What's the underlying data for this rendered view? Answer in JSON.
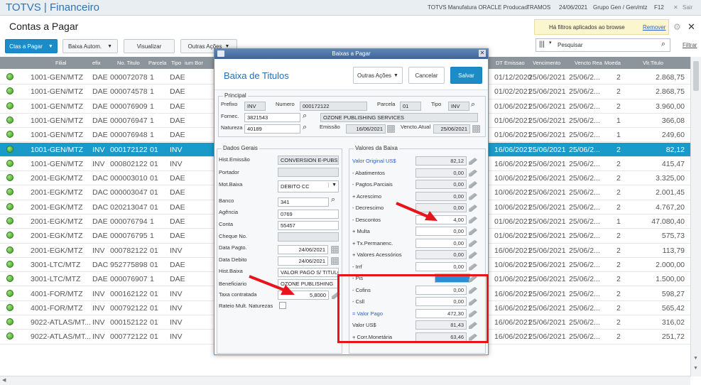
{
  "app": {
    "title": "TOTVS | Financeiro",
    "company": "TOTVS Manufatura ORACLE Producao",
    "user": "TRAMOS",
    "date": "24/06/2021",
    "group": "Grupo Gen / Gen/mtz",
    "key": "F12",
    "exit": "Sair"
  },
  "page": {
    "title": "Contas a Pagar",
    "filter_notice": "Há filtros aplicados ao browse",
    "filter_remove": "Remover",
    "search_placeholder": "Pesquisar",
    "filtrar": "Filtrar"
  },
  "toolbar": {
    "ctas": "Ctas a Pagar",
    "baixa": "Baixa Autom.",
    "visualizar": "Visualizar",
    "outras": "Outras Ações"
  },
  "grid": {
    "headers": [
      "Filial",
      "efix",
      "No. Titulo",
      "Parcela",
      "Tipo",
      "ium Bor",
      "DT Emissao",
      "Vencimento",
      "Vencto Rea",
      "Moeda",
      "Vlr.Titulo"
    ],
    "rows": [
      {
        "filial": "1001-GEN/MTZ",
        "pref": "DAE",
        "titulo": "000072078",
        "parc": "1",
        "tipo": "DAE",
        "emissao": "01/12/2020",
        "venc": "25/06/2021",
        "vreal": "25/06/2...",
        "moeda": "2",
        "valor": "2.868,75"
      },
      {
        "filial": "1001-GEN/MTZ",
        "pref": "DAE",
        "titulo": "000074578",
        "parc": "1",
        "tipo": "DAE",
        "emissao": "01/02/2021",
        "venc": "25/06/2021",
        "vreal": "25/06/2...",
        "moeda": "2",
        "valor": "2.868,75"
      },
      {
        "filial": "1001-GEN/MTZ",
        "pref": "DAE",
        "titulo": "000076909",
        "parc": "1",
        "tipo": "DAE",
        "emissao": "01/06/2021",
        "venc": "25/06/2021",
        "vreal": "25/06/2...",
        "moeda": "2",
        "valor": "3.960,00"
      },
      {
        "filial": "1001-GEN/MTZ",
        "pref": "DAE",
        "titulo": "000076947",
        "parc": "1",
        "tipo": "DAE",
        "emissao": "01/06/2021",
        "venc": "25/06/2021",
        "vreal": "25/06/2...",
        "moeda": "1",
        "valor": "366,08"
      },
      {
        "filial": "1001-GEN/MTZ",
        "pref": "DAE",
        "titulo": "000076948",
        "parc": "1",
        "tipo": "DAE",
        "emissao": "01/06/2021",
        "venc": "25/06/2021",
        "vreal": "25/06/2...",
        "moeda": "1",
        "valor": "249,60"
      },
      {
        "filial": "1001-GEN/MTZ",
        "pref": "INV",
        "titulo": "000172122",
        "parc": "01",
        "tipo": "INV",
        "emissao": "16/06/2021",
        "venc": "25/06/2021",
        "vreal": "25/06/2...",
        "moeda": "2",
        "valor": "82,12"
      },
      {
        "filial": "1001-GEN/MTZ",
        "pref": "INV",
        "titulo": "000802122",
        "parc": "01",
        "tipo": "INV",
        "emissao": "16/06/2021",
        "venc": "25/06/2021",
        "vreal": "25/06/2...",
        "moeda": "2",
        "valor": "415,47"
      },
      {
        "filial": "2001-EGK/MTZ",
        "pref": "DAC",
        "titulo": "000003010",
        "parc": "01",
        "tipo": "DAE",
        "emissao": "10/06/2021",
        "venc": "25/06/2021",
        "vreal": "25/06/2...",
        "moeda": "2",
        "valor": "3.325,00"
      },
      {
        "filial": "2001-EGK/MTZ",
        "pref": "DAC",
        "titulo": "000003047",
        "parc": "01",
        "tipo": "DAE",
        "emissao": "10/06/2021",
        "venc": "25/06/2021",
        "vreal": "25/06/2...",
        "moeda": "2",
        "valor": "2.001,45"
      },
      {
        "filial": "2001-EGK/MTZ",
        "pref": "DAC",
        "titulo": "020213047",
        "parc": "01",
        "tipo": "DAE",
        "emissao": "10/06/2021",
        "venc": "25/06/2021",
        "vreal": "25/06/2...",
        "moeda": "2",
        "valor": "4.767,20"
      },
      {
        "filial": "2001-EGK/MTZ",
        "pref": "DAE",
        "titulo": "000076794",
        "parc": "1",
        "tipo": "DAE",
        "emissao": "01/06/2021",
        "venc": "25/06/2021",
        "vreal": "25/06/2...",
        "moeda": "1",
        "valor": "47.080,40"
      },
      {
        "filial": "2001-EGK/MTZ",
        "pref": "DAE",
        "titulo": "000076795",
        "parc": "1",
        "tipo": "DAE",
        "emissao": "01/06/2021",
        "venc": "25/06/2021",
        "vreal": "25/06/2...",
        "moeda": "2",
        "valor": "575,73"
      },
      {
        "filial": "2001-EGK/MTZ",
        "pref": "INV",
        "titulo": "000782122",
        "parc": "01",
        "tipo": "INV",
        "emissao": "16/06/2021",
        "venc": "25/06/2021",
        "vreal": "25/06/2...",
        "moeda": "2",
        "valor": "113,79"
      },
      {
        "filial": "3001-LTC/MTZ",
        "pref": "DAC",
        "titulo": "952775898",
        "parc": "01",
        "tipo": "DAE",
        "emissao": "10/06/2021",
        "venc": "25/06/2021",
        "vreal": "25/06/2...",
        "moeda": "2",
        "valor": "2.000,00"
      },
      {
        "filial": "3001-LTC/MTZ",
        "pref": "DAE",
        "titulo": "000076907",
        "parc": "1",
        "tipo": "DAE",
        "emissao": "01/06/2021",
        "venc": "25/06/2021",
        "vreal": "25/06/2...",
        "moeda": "2",
        "valor": "1.500,00"
      },
      {
        "filial": "4001-FOR/MTZ",
        "pref": "INV",
        "titulo": "000162122",
        "parc": "01",
        "tipo": "INV",
        "emissao": "16/06/2021",
        "venc": "25/06/2021",
        "vreal": "25/06/2...",
        "moeda": "2",
        "valor": "598,27"
      },
      {
        "filial": "4001-FOR/MTZ",
        "pref": "INV",
        "titulo": "000792122",
        "parc": "01",
        "tipo": "INV",
        "emissao": "16/06/2021",
        "venc": "25/06/2021",
        "vreal": "25/06/2...",
        "moeda": "2",
        "valor": "565,42"
      },
      {
        "filial": "9022-ATLAS/MT...",
        "pref": "INV",
        "titulo": "000152122",
        "parc": "01",
        "tipo": "INV",
        "emissao": "16/06/2021",
        "venc": "25/06/2021",
        "vreal": "25/06/2...",
        "moeda": "2",
        "valor": "316,02"
      },
      {
        "filial": "9022-ATLAS/MT...",
        "pref": "INV",
        "titulo": "000772122",
        "parc": "01",
        "tipo": "INV",
        "emissao": "16/06/2021",
        "venc": "25/06/2021",
        "vreal": "25/06/2...",
        "moeda": "2",
        "valor": "251,72"
      }
    ]
  },
  "modal": {
    "titlebar": "Baixas a Pagar",
    "title": "Baixa de Titulos",
    "outras": "Outras Ações",
    "cancelar": "Cancelar",
    "salvar": "Salvar",
    "principal": {
      "legend": "Principal",
      "prefixo_lbl": "Prefixo",
      "prefixo": "INV",
      "numero_lbl": "Numero",
      "numero": "000172122",
      "parcela_lbl": "Parcela",
      "parcela": "01",
      "tipo_lbl": "Tipo",
      "tipo": "INV",
      "fornec_lbl": "Fornec.",
      "fornec": "3821543",
      "fornec_nome": "OZONE PUBLISHING SERVICES",
      "natureza_lbl": "Natureza",
      "natureza": "40189",
      "emissao_lbl": "Emissão",
      "emissao": "16/06/2021",
      "vencto_lbl": "Vencto.Atual",
      "vencto": "25/06/2021"
    },
    "gerais": {
      "legend": "Dados Gerais",
      "hist_emissao_lbl": "Hist.Emissão",
      "hist_emissao": "CONVERSION E-PUBS",
      "portador_lbl": "Portador",
      "mot_baixa_lbl": "Mot.Baixa",
      "mot_baixa": "DEBITO CC",
      "banco_lbl": "Banco",
      "banco": "341",
      "agencia_lbl": "Agência",
      "agencia": "0769",
      "conta_lbl": "Conta",
      "conta": "55457",
      "cheque_lbl": "Cheque No.",
      "data_pagto_lbl": "Data Pagto.",
      "data_pagto": "24/06/2021",
      "data_debito_lbl": "Data Debito",
      "data_debito": "24/06/2021",
      "hist_baixa_lbl": "Hist.Baixa",
      "hist_baixa": "VALOR PAGO S/ TITULO",
      "beneficiario_lbl": "Beneficiario",
      "beneficiario": "OZONE PUBLISHING",
      "taxa_lbl": "Taxa contratada",
      "taxa": "5,8000",
      "rateio_lbl": "Rateio Mult. Naturezas"
    },
    "valores": {
      "legend": "Valores da Baixa",
      "items": [
        {
          "label": "Valor Original US$",
          "value": "82,12",
          "blue": true
        },
        {
          "label": "- Abatimentos",
          "value": "0,00"
        },
        {
          "label": "- Pagtos.Parciais",
          "value": "0,00"
        },
        {
          "label": "+ Acrescimo",
          "value": "0,00"
        },
        {
          "label": "- Decrescimo",
          "value": "0,00"
        },
        {
          "label": "- Descontos",
          "value": "4,00",
          "white": true
        },
        {
          "label": "+ Multa",
          "value": "0,00",
          "white": true
        },
        {
          "label": "+ Tx.Permanenc.",
          "value": "0,00",
          "white": true
        },
        {
          "label": "+ Valores Acessórios",
          "value": "0,00"
        },
        {
          "label": "- Irrf",
          "value": "0,00",
          "white": true
        },
        {
          "label": "- Pis",
          "value": "",
          "hidden": true
        },
        {
          "label": "- Cofins",
          "value": "0,00",
          "white": true
        },
        {
          "label": "- Csll",
          "value": "0,00",
          "white": true
        },
        {
          "label": "= Valor Pago",
          "value": "472,30",
          "blue": true,
          "white": true
        },
        {
          "label": "Valor US$",
          "value": "81,43"
        },
        {
          "label": "+ Corr.Monetária",
          "value": "63,46"
        }
      ]
    }
  },
  "colors": {
    "accent": "#1a9ac9",
    "highlight_box": "#e8141b",
    "arrow": "#e8141b",
    "status_green": "#3d9a22"
  }
}
